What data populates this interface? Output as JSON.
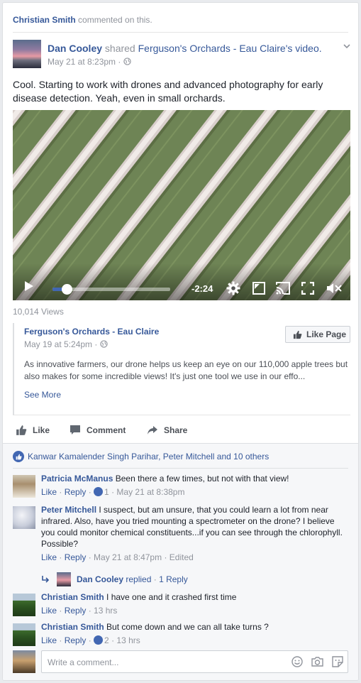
{
  "activity": {
    "actor": "Christian Smith",
    "text": "commented on this."
  },
  "post": {
    "author": "Dan Cooley",
    "shared_text": "shared",
    "shared_page": "Ferguson's Orchards - Eau Claire",
    "shared_suffix": "'s video.",
    "time": "May 21 at 8:23pm",
    "separator": "·",
    "text": "Cool. Starting to work with drones and advanced photography for early disease detection. Yeah, even in small orchards."
  },
  "video": {
    "time_remaining": "-2:24",
    "progress_fraction": 0.12,
    "views": "10,014 Views"
  },
  "shared_post": {
    "page_name": "Ferguson's Orchards - Eau Claire",
    "time": "May 19 at 5:24pm",
    "like_page_label": "Like Page",
    "body": "As innovative farmers, our drone helps us keep an eye on our 110,000 apple trees but also makes for some incredible views! It's just one tool we use in our effo...",
    "see_more": "See More"
  },
  "actions": {
    "like": "Like",
    "comment": "Comment",
    "share": "Share"
  },
  "likers": "Kanwar Kamalender Singh Parihar, Peter Mitchell and 10 others",
  "comments": [
    {
      "author": "Patricia McManus",
      "text": "Been there a few times, but not with that view!",
      "like": "Like",
      "reply": "Reply",
      "likes": "1",
      "time": "May 21 at 8:38pm"
    },
    {
      "author": "Peter Mitchell",
      "text": "I suspect, but am unsure, that you could learn a lot from near infrared. Also, have you tried mounting a spectrometer on the drone? I believe you could monitor chemical constituents...if you can see through the chlorophyll. Possible?",
      "like": "Like",
      "reply": "Reply",
      "time": "May 21 at 8:47pm",
      "edited": "Edited"
    },
    {
      "author": "Christian Smith",
      "text": "I have one and it crashed first time",
      "like": "Like",
      "reply": "Reply",
      "time": "13 hrs"
    },
    {
      "author": "Christian Smith",
      "text": "But come down and we can all take turns ?",
      "like": "Like",
      "reply": "Reply",
      "likes": "2",
      "time": "13 hrs"
    }
  ],
  "reply_summary": {
    "author": "Dan Cooley",
    "text": "replied",
    "count": "1 Reply"
  },
  "composer": {
    "placeholder": "Write a comment..."
  },
  "colors": {
    "link": "#365899",
    "muted": "#90949c",
    "accent": "#4267b2"
  }
}
